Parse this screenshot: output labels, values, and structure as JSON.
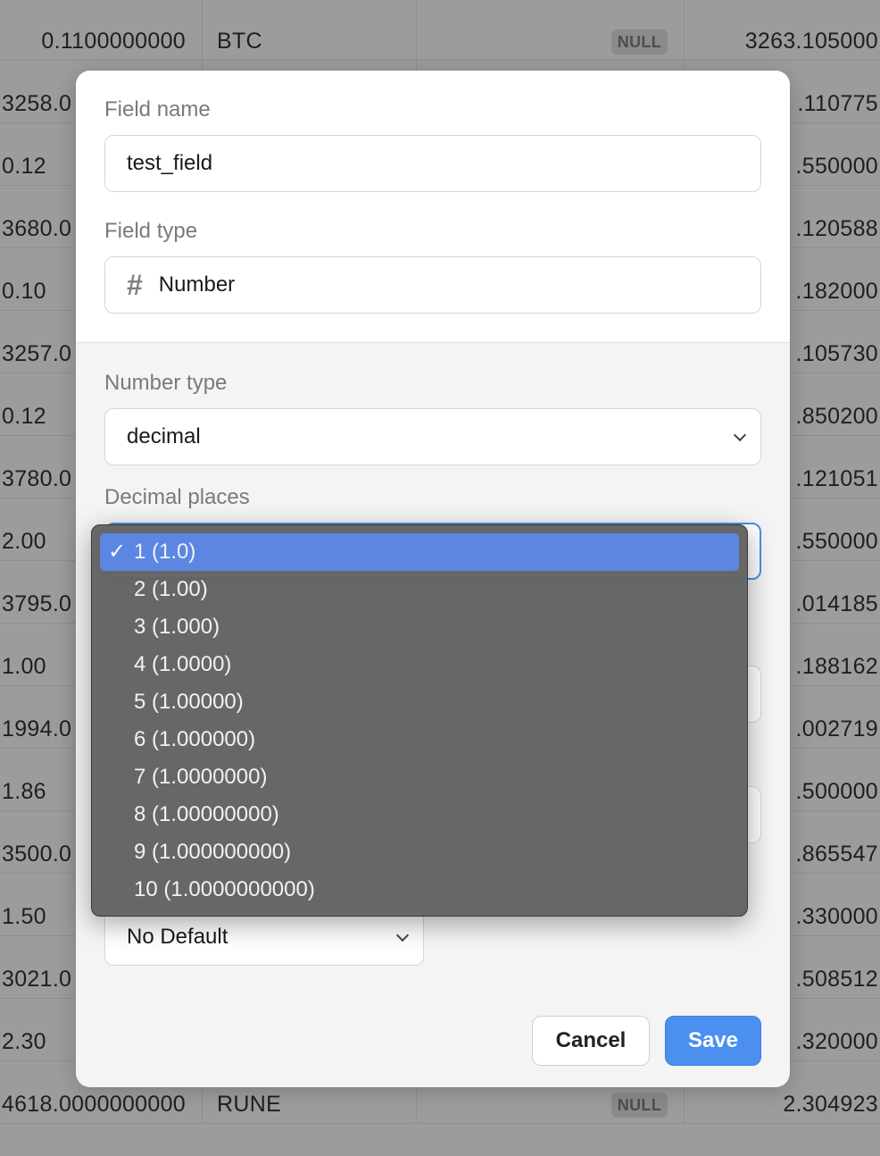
{
  "table": {
    "rows": [
      {
        "c1": "0.1100000000",
        "c2": "BTC",
        "c3": "NULL",
        "c4": "3263.105000"
      },
      {
        "c1": "3258.0",
        "c2": "",
        "c3": "",
        "c4": ".110775"
      },
      {
        "c1": "0.12",
        "c2": "",
        "c3": "",
        "c4": ".550000"
      },
      {
        "c1": "3680.0",
        "c2": "",
        "c3": "",
        "c4": ".120588"
      },
      {
        "c1": "0.10",
        "c2": "",
        "c3": "",
        "c4": ".182000"
      },
      {
        "c1": "3257.0",
        "c2": "",
        "c3": "",
        "c4": ".105730"
      },
      {
        "c1": "0.12",
        "c2": "",
        "c3": "",
        "c4": ".850200"
      },
      {
        "c1": "3780.0",
        "c2": "",
        "c3": "",
        "c4": ".121051"
      },
      {
        "c1": "2.00",
        "c2": "",
        "c3": "",
        "c4": ".550000"
      },
      {
        "c1": "3795.0",
        "c2": "",
        "c3": "",
        "c4": ".014185"
      },
      {
        "c1": "1.00",
        "c2": "",
        "c3": "",
        "c4": ".188162"
      },
      {
        "c1": "1994.0",
        "c2": "",
        "c3": "",
        "c4": ".002719"
      },
      {
        "c1": "1.86",
        "c2": "",
        "c3": "",
        "c4": ".500000"
      },
      {
        "c1": "3500.0",
        "c2": "",
        "c3": "",
        "c4": ".865547"
      },
      {
        "c1": "1.50",
        "c2": "",
        "c3": "",
        "c4": ".330000"
      },
      {
        "c1": "3021.0",
        "c2": "",
        "c3": "",
        "c4": ".508512"
      },
      {
        "c1": "2.30",
        "c2": "",
        "c3": "",
        "c4": ".320000"
      },
      {
        "c1": "4618.0000000000",
        "c2": "RUNE",
        "c3": "NULL",
        "c4": "2.304923"
      }
    ]
  },
  "modal": {
    "field_name_label": "Field name",
    "field_name_value": "test_field",
    "field_type_label": "Field type",
    "field_type_icon": "hash-icon",
    "field_type_value": "Number",
    "number_type_label": "Number type",
    "number_type_value": "decimal",
    "decimal_places_label": "Decimal places",
    "default_value": "No Default",
    "cancel_label": "Cancel",
    "save_label": "Save"
  },
  "menu": {
    "items": [
      "1 (1.0)",
      "2 (1.00)",
      "3 (1.000)",
      "4 (1.0000)",
      "5 (1.00000)",
      "6 (1.000000)",
      "7 (1.0000000)",
      "8 (1.00000000)",
      "9 (1.000000000)",
      "10 (1.0000000000)"
    ],
    "selected_index": 0,
    "check_glyph": "✓"
  },
  "colors": {
    "accent": "#4b8ff0",
    "menu_selected": "#5b87e3",
    "menu_bg": "#626262"
  }
}
